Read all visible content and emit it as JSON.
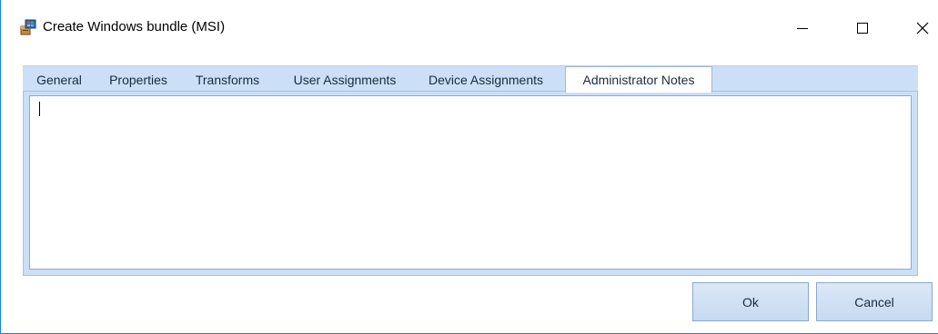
{
  "window": {
    "title": "Create Windows bundle (MSI)",
    "icon": "installer-package-icon",
    "accent_color": "#1883d7"
  },
  "tabs": [
    {
      "label": "General",
      "active": false
    },
    {
      "label": "Properties",
      "active": false
    },
    {
      "label": "Transforms",
      "active": false
    },
    {
      "label": "User Assignments",
      "active": false
    },
    {
      "label": "Device Assignments",
      "active": false
    },
    {
      "label": "Administrator Notes",
      "active": true
    }
  ],
  "notes": {
    "value": ""
  },
  "buttons": {
    "ok_label": "Ok",
    "cancel_label": "Cancel"
  }
}
